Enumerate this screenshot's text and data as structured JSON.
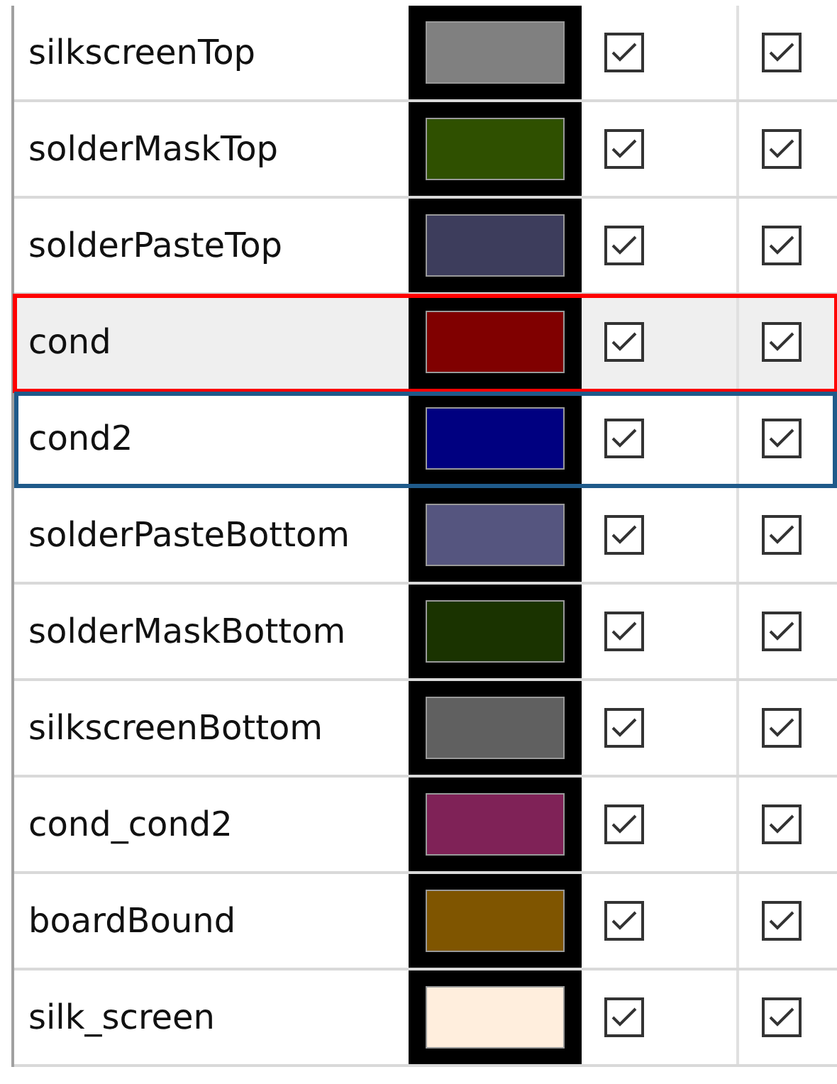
{
  "layers": [
    {
      "name": "silkscreenTop",
      "color": "#808080",
      "visible": true,
      "enabled": true,
      "selected": false,
      "focused": false
    },
    {
      "name": "solderMaskTop",
      "color": "#2f5000",
      "visible": true,
      "enabled": true,
      "selected": false,
      "focused": false
    },
    {
      "name": "solderPasteTop",
      "color": "#3d3d5c",
      "visible": true,
      "enabled": true,
      "selected": false,
      "focused": false
    },
    {
      "name": "cond",
      "color": "#800000",
      "visible": true,
      "enabled": true,
      "selected": true,
      "focused": false
    },
    {
      "name": "cond2",
      "color": "#000080",
      "visible": true,
      "enabled": true,
      "selected": false,
      "focused": true
    },
    {
      "name": "solderPasteBottom",
      "color": "#55557f",
      "visible": true,
      "enabled": true,
      "selected": false,
      "focused": false
    },
    {
      "name": "solderMaskBottom",
      "color": "#1a3300",
      "visible": true,
      "enabled": true,
      "selected": false,
      "focused": false
    },
    {
      "name": "silkscreenBottom",
      "color": "#606060",
      "visible": true,
      "enabled": true,
      "selected": false,
      "focused": false
    },
    {
      "name": "cond_cond2",
      "color": "#7f2257",
      "visible": true,
      "enabled": true,
      "selected": false,
      "focused": false
    },
    {
      "name": "boardBound",
      "color": "#7f5500",
      "visible": true,
      "enabled": true,
      "selected": false,
      "focused": false
    },
    {
      "name": "silk_screen",
      "color": "#ffeedd",
      "visible": true,
      "enabled": true,
      "selected": false,
      "focused": false
    }
  ]
}
